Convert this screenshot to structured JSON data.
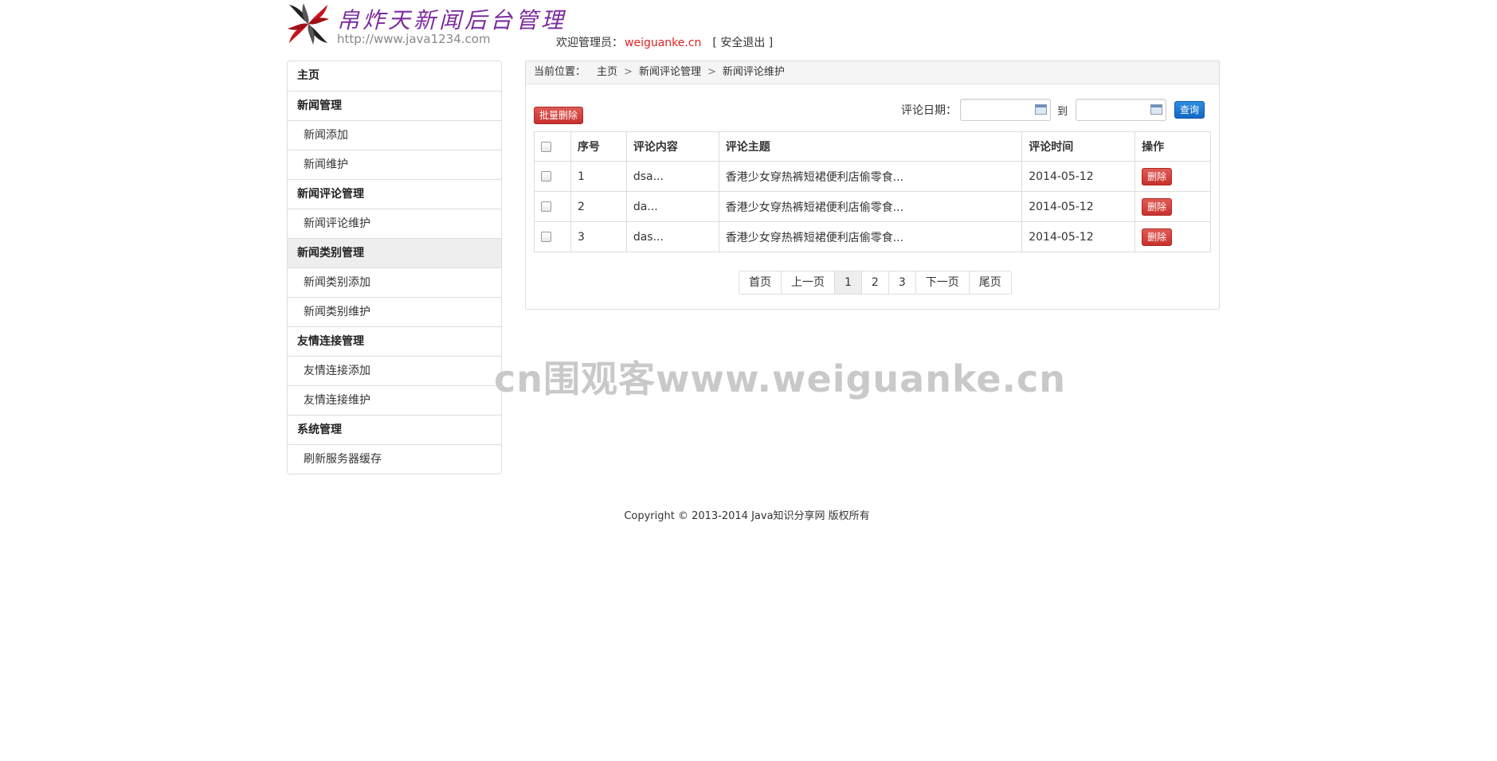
{
  "header": {
    "logo_title": "帛炸天新闻后台管理",
    "logo_url": "http://www.java1234.com",
    "welcome_label": "欢迎管理员：",
    "username": "weiguanke.cn",
    "logout": "[ 安全退出 ]",
    "colors": {
      "title": "#7b2c9e",
      "username": "#e02020"
    }
  },
  "sidebar": {
    "items": [
      {
        "label": "主页",
        "type": "group"
      },
      {
        "label": "新闻管理",
        "type": "group"
      },
      {
        "label": "新闻添加",
        "type": "sub"
      },
      {
        "label": "新闻维护",
        "type": "sub"
      },
      {
        "label": "新闻评论管理",
        "type": "group"
      },
      {
        "label": "新闻评论维护",
        "type": "sub"
      },
      {
        "label": "新闻类别管理",
        "type": "group",
        "active": true
      },
      {
        "label": "新闻类别添加",
        "type": "sub"
      },
      {
        "label": "新闻类别维护",
        "type": "sub"
      },
      {
        "label": "友情连接管理",
        "type": "group"
      },
      {
        "label": "友情连接添加",
        "type": "sub"
      },
      {
        "label": "友情连接维护",
        "type": "sub"
      },
      {
        "label": "系统管理",
        "type": "group"
      },
      {
        "label": "刷新服务器缓存",
        "type": "sub"
      }
    ]
  },
  "breadcrumb": {
    "lead": "当前位置：",
    "crumbs": [
      "主页",
      "新闻评论管理",
      "新闻评论维护"
    ],
    "separator": ">"
  },
  "toolbar": {
    "batch_delete": "批量删除",
    "date_label": "评论日期：",
    "to_label": "到",
    "search": "查询",
    "date_from": "",
    "date_to": ""
  },
  "table": {
    "headers": [
      "",
      "序号",
      "评论内容",
      "评论主题",
      "评论时间",
      "操作"
    ],
    "rows": [
      {
        "id": "1",
        "content": "dsa...",
        "topic": "香港少女穿热裤短裙便利店偷零食...",
        "time": "2014-05-12",
        "action": "删除"
      },
      {
        "id": "2",
        "content": "da...",
        "topic": "香港少女穿热裤短裙便利店偷零食...",
        "time": "2014-05-12",
        "action": "删除"
      },
      {
        "id": "3",
        "content": "das...",
        "topic": "香港少女穿热裤短裙便利店偷零食...",
        "time": "2014-05-12",
        "action": "删除"
      }
    ]
  },
  "pagination": {
    "first": "首页",
    "prev": "上一页",
    "pages": [
      "1",
      "2",
      "3"
    ],
    "current": "1",
    "next": "下一页",
    "last": "尾页"
  },
  "watermark": "cn围观客www.weiguanke.cn",
  "footer": {
    "copyright": "Copyright © 2013-2014 Java知识分享网 版权所有"
  }
}
